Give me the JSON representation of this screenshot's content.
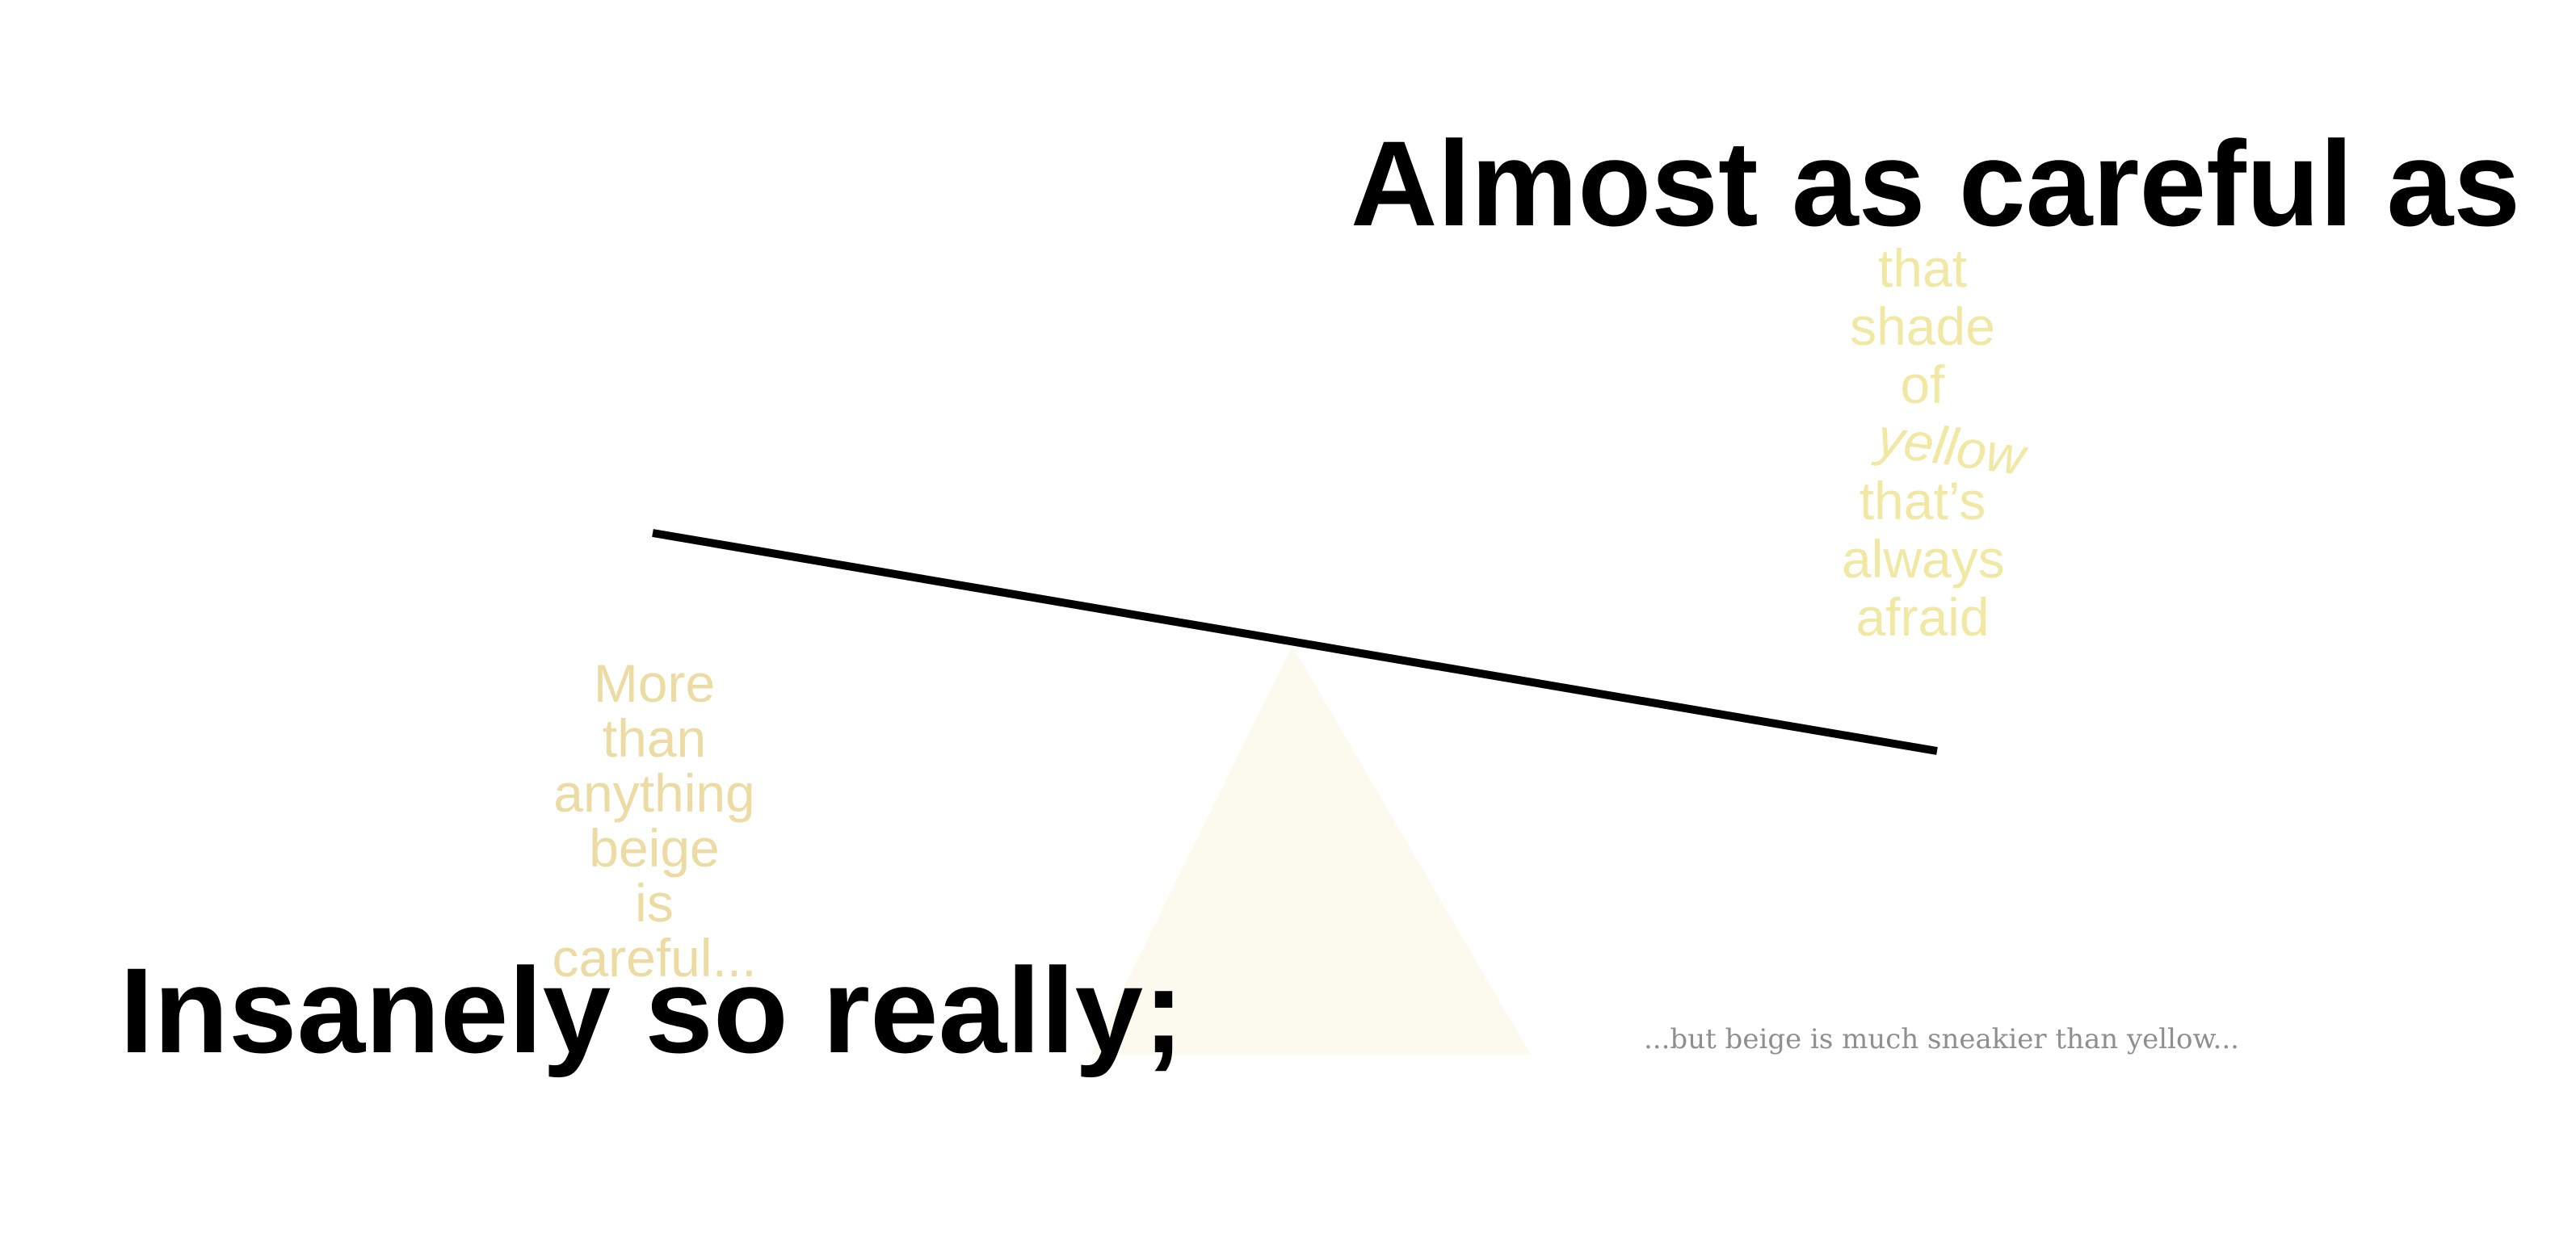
{
  "headline_top": "Almost as careful as",
  "headline_bottom": "Insanely so really;",
  "yellow_words": [
    "that",
    "shade",
    "of",
    "yellow",
    "that’s",
    "always",
    "afraid"
  ],
  "beige_words": [
    "More",
    "than",
    "anything",
    "beige",
    "is",
    "careful..."
  ],
  "caption": "...but beige is much sneakier than yellow...",
  "colors": {
    "ink": "#000000",
    "yellow_text": "#f1e8a4",
    "beige_text": "#ecdba3",
    "fulcrum_fill": "#fcf9ee",
    "caption_text": "#8f8f8f"
  }
}
